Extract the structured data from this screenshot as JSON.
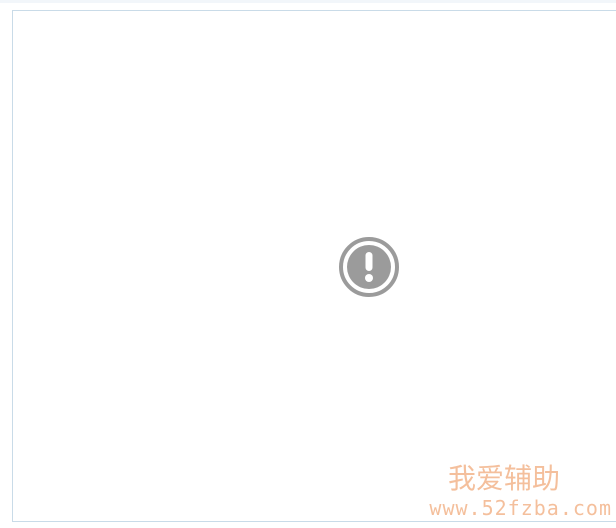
{
  "content": {
    "status_icon": "error-exclamation-icon"
  },
  "watermark": {
    "title": "我爱辅助",
    "url": "www.52fzba.com",
    "color": "#f3b58b"
  },
  "colors": {
    "frame_border": "#c9dbe8",
    "icon": "#9b9b9b"
  }
}
